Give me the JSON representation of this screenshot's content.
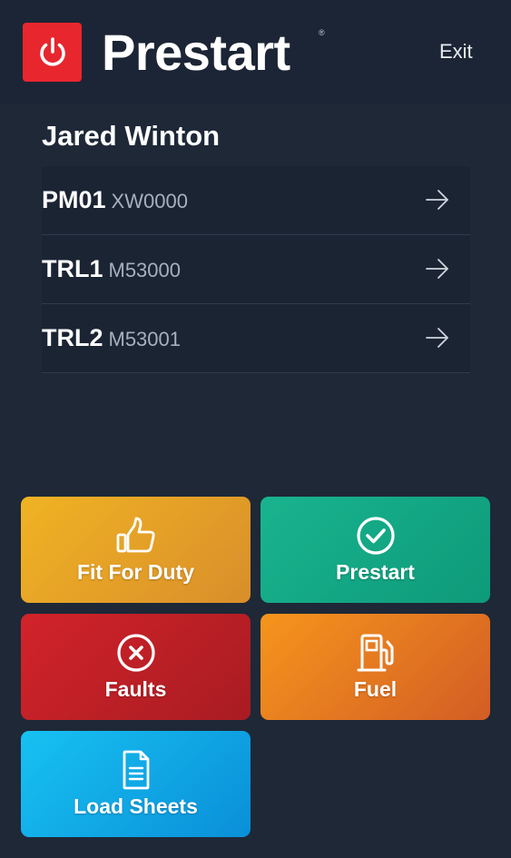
{
  "header": {
    "app_title": "Prestart",
    "registered_mark": "®",
    "exit_label": "Exit",
    "logo_icon": "power-icon",
    "logo_color": "#e8262e"
  },
  "driver": {
    "name": "Jared Winton"
  },
  "vehicles": [
    {
      "code": "PM01",
      "registration": "XW0000",
      "icon": "arrow-right-icon"
    },
    {
      "code": "TRL1",
      "registration": "M53000",
      "icon": "arrow-right-icon"
    },
    {
      "code": "TRL2",
      "registration": "M53001",
      "icon": "arrow-right-icon"
    }
  ],
  "tiles": {
    "fit_for_duty": {
      "label": "Fit For Duty",
      "icon": "thumbs-up-icon",
      "color": "#f0b323"
    },
    "prestart": {
      "label": "Prestart",
      "icon": "check-circle-icon",
      "color": "#19b48f"
    },
    "faults": {
      "label": "Faults",
      "icon": "x-circle-icon",
      "color": "#d2232a"
    },
    "fuel": {
      "label": "Fuel",
      "icon": "fuel-pump-icon",
      "color": "#f6951c"
    },
    "load_sheets": {
      "label": "Load Sheets",
      "icon": "document-icon",
      "color": "#17c1f2"
    }
  },
  "colors": {
    "background": "#1e2837",
    "header": "#1c2535"
  }
}
